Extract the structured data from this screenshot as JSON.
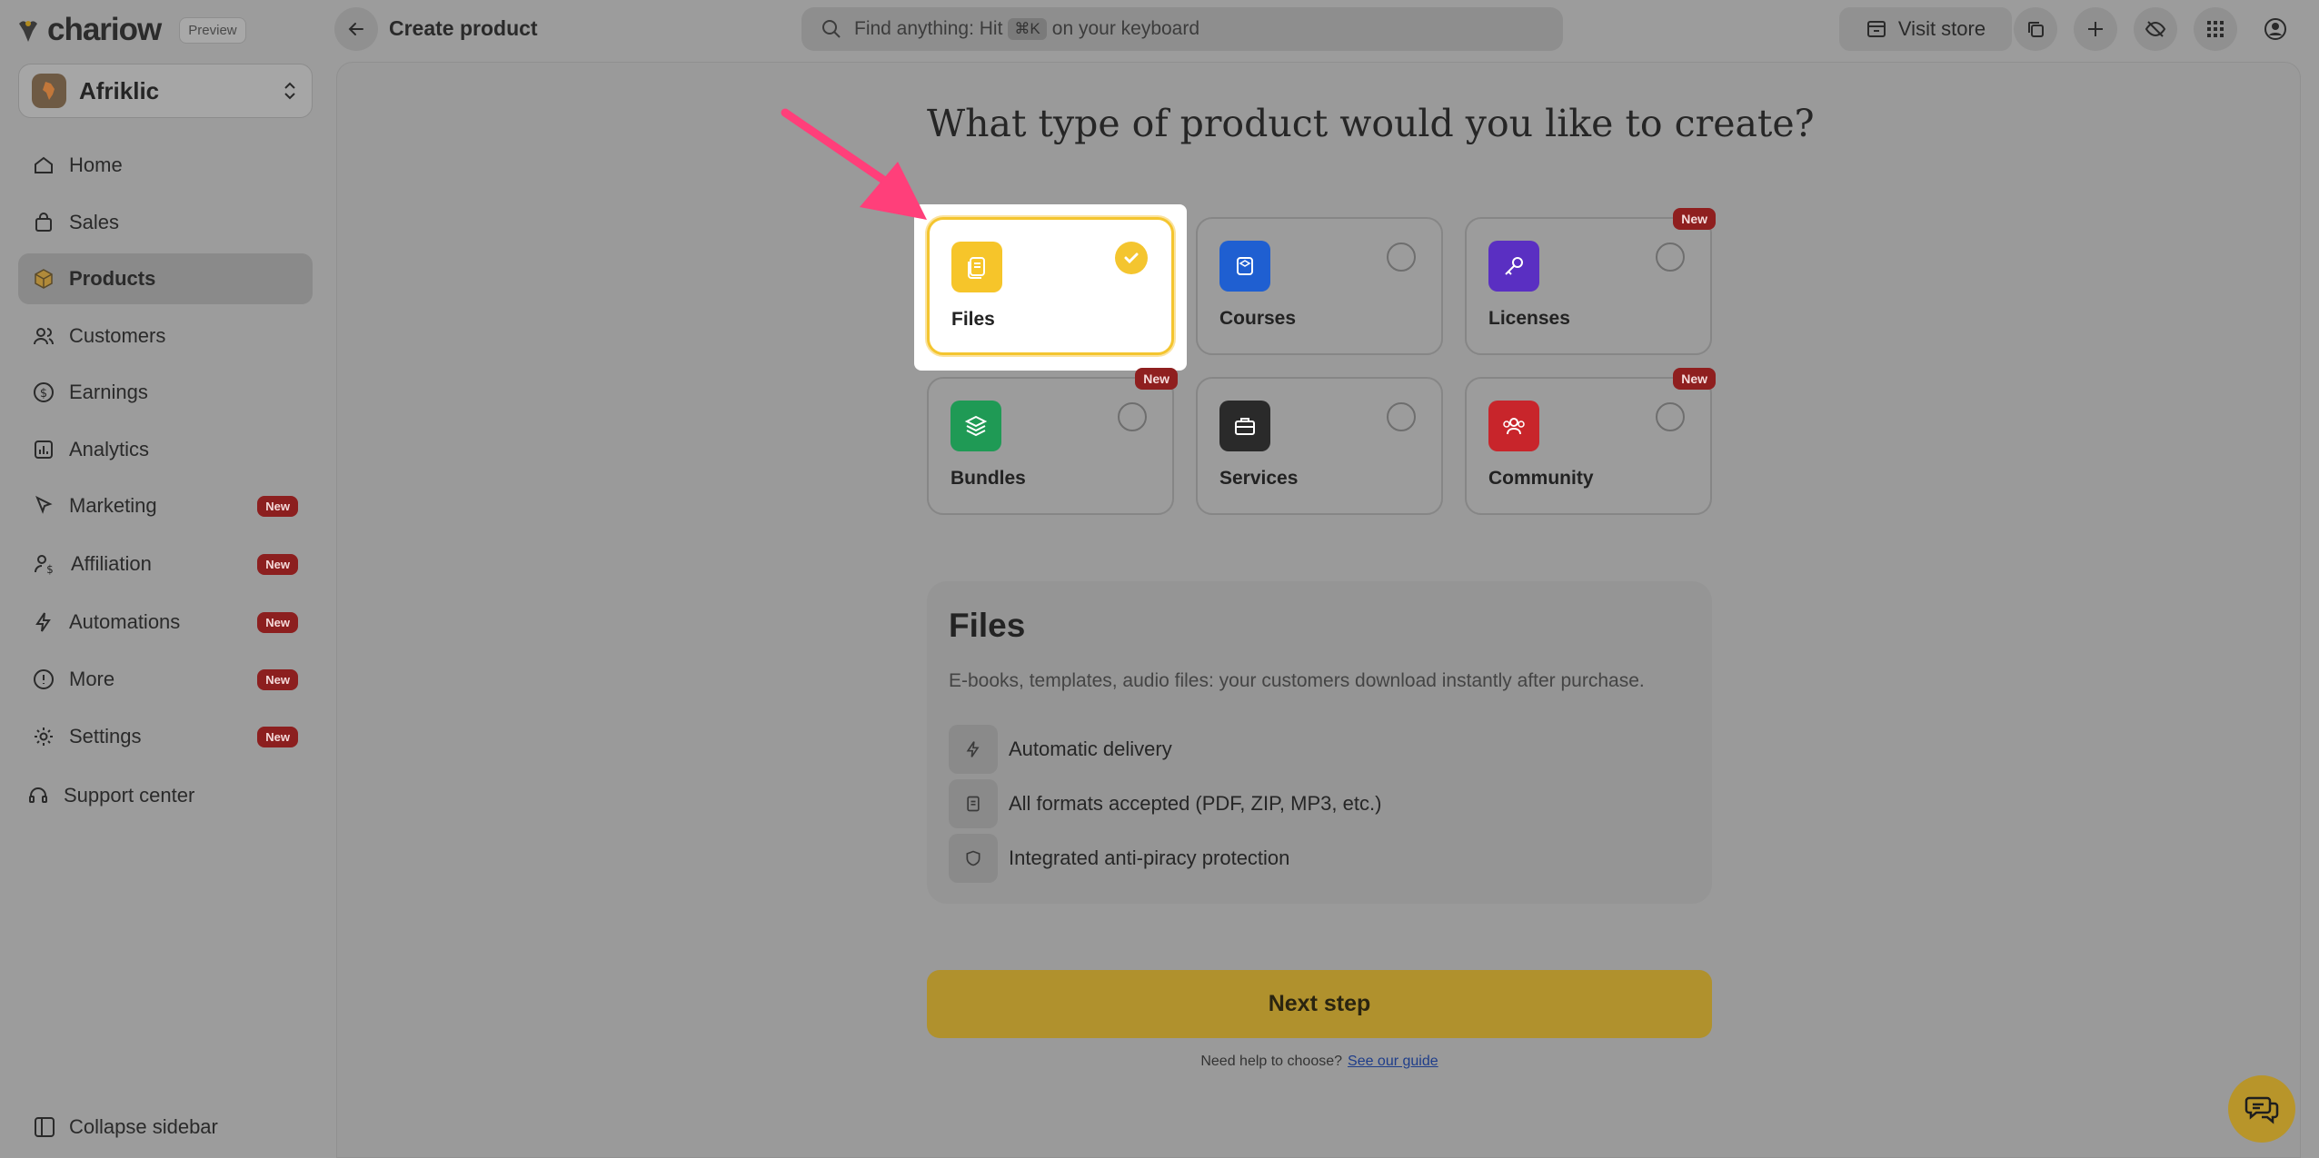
{
  "colors": {
    "overlay_bg": "#9c9c9c",
    "selected_border": "#f4c52f",
    "next_button": "#b0912d",
    "new_badge": "#8f1f1f",
    "arrow": "#ff3f7a",
    "files_icon": "#f6c52a",
    "courses_icon": "#1f5fd1",
    "licenses_icon": "#5a2fc2",
    "bundles_icon": "#1f9a55",
    "services_icon": "#2a2a2a",
    "community_icon": "#c8252b"
  },
  "app": {
    "brand": "chariow",
    "preview_label": "Preview"
  },
  "header": {
    "title": "Create product",
    "search_placeholder_pre": "Find anything: Hit",
    "search_kbd": "⌘K",
    "search_placeholder_post": "on your keyboard",
    "visit_store_label": "Visit store"
  },
  "workspace": {
    "name": "Afriklic"
  },
  "sidebar": {
    "items": [
      {
        "label": "Home",
        "icon": "home-icon"
      },
      {
        "label": "Sales",
        "icon": "shopping-bag-icon"
      },
      {
        "label": "Products",
        "icon": "box-icon",
        "active": true
      },
      {
        "label": "Customers",
        "icon": "users-icon"
      },
      {
        "label": "Earnings",
        "icon": "dollar-icon"
      },
      {
        "label": "Analytics",
        "icon": "chart-icon"
      },
      {
        "label": "Marketing",
        "icon": "cursor-icon",
        "badge": "New"
      },
      {
        "label": "Affiliation",
        "icon": "user-dollar-icon",
        "badge": "New"
      },
      {
        "label": "Automations",
        "icon": "bolt-icon",
        "badge": "New"
      },
      {
        "label": "More",
        "icon": "info-icon",
        "badge": "New"
      },
      {
        "label": "Settings",
        "icon": "gear-icon",
        "badge": "New"
      }
    ],
    "support_label": "Support center",
    "collapse_label": "Collapse sidebar"
  },
  "main": {
    "heading": "What type of product would you like to create?",
    "product_types": [
      {
        "label": "Files",
        "selected": true
      },
      {
        "label": "Courses"
      },
      {
        "label": "Licenses",
        "badge": "New"
      },
      {
        "label": "Bundles",
        "badge": "New"
      },
      {
        "label": "Services"
      },
      {
        "label": "Community",
        "badge": "New"
      }
    ],
    "info": {
      "title": "Files",
      "description": "E-books, templates, audio files: your customers download instantly after purchase.",
      "features": [
        "Automatic delivery",
        "All formats accepted (PDF, ZIP, MP3, etc.)",
        "Integrated anti-piracy protection"
      ]
    },
    "next_label": "Next step",
    "help_text": "Need help to choose?",
    "help_link": "See our guide"
  }
}
